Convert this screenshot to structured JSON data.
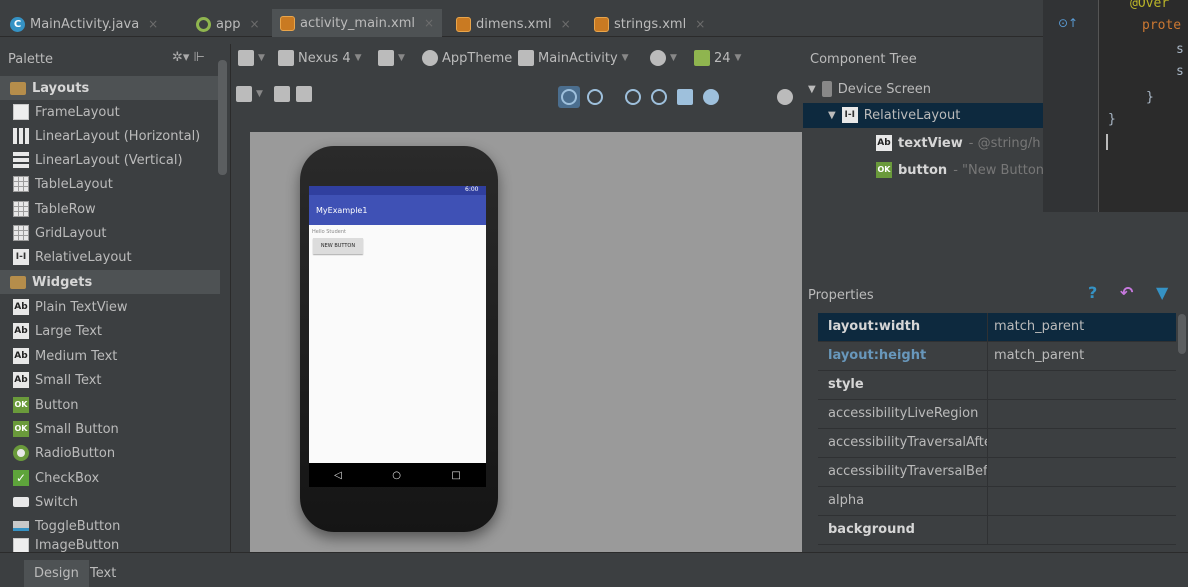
{
  "tabs": [
    {
      "label": "MainActivity.java",
      "icon": "java-class-icon"
    },
    {
      "label": "app",
      "icon": "app-module-icon"
    },
    {
      "label": "activity_main.xml",
      "icon": "xml-file-icon"
    },
    {
      "label": "dimens.xml",
      "icon": "xml-file-icon"
    },
    {
      "label": "strings.xml",
      "icon": "xml-file-icon"
    }
  ],
  "tab_close": "×",
  "palette": {
    "title": "Palette",
    "items": [
      {
        "label": "Layouts",
        "group": true
      },
      {
        "label": "FrameLayout"
      },
      {
        "label": "LinearLayout (Horizontal)"
      },
      {
        "label": "LinearLayout (Vertical)"
      },
      {
        "label": "TableLayout"
      },
      {
        "label": "TableRow"
      },
      {
        "label": "GridLayout"
      },
      {
        "label": "RelativeLayout"
      },
      {
        "label": "Widgets",
        "group": true
      },
      {
        "label": "Plain TextView"
      },
      {
        "label": "Large Text"
      },
      {
        "label": "Medium Text"
      },
      {
        "label": "Small Text"
      },
      {
        "label": "Button"
      },
      {
        "label": "Small Button"
      },
      {
        "label": "RadioButton"
      },
      {
        "label": "CheckBox"
      },
      {
        "label": "Switch"
      },
      {
        "label": "ToggleButton"
      },
      {
        "label": "ImageButton"
      }
    ],
    "icon_text": {
      "ab": "Ab",
      "ok": "OK",
      "rel": "I-I"
    }
  },
  "toolbar": {
    "device": "Nexus 4",
    "theme": "AppTheme",
    "activity": "MainActivity",
    "api": "24"
  },
  "preview": {
    "status_time": "6:00",
    "app_title": "MyExample1",
    "hello_text": "Hello Student",
    "button_text": "NEW BUTTON",
    "nav": [
      "◁",
      "○",
      "□"
    ]
  },
  "component_tree": {
    "title": "Component Tree",
    "device_screen": "Device Screen",
    "relative_layout": "RelativeLayout",
    "text_view": {
      "name": "textView",
      "detail": " - @string/h"
    },
    "button": {
      "name": "button",
      "detail": " - \"New Button"
    }
  },
  "editor": {
    "lines": [
      "@Over",
      "prote",
      "s",
      "s",
      "}",
      "}"
    ]
  },
  "properties": {
    "title": "Properties",
    "rows": [
      {
        "key": "layout:width",
        "value": "match_parent"
      },
      {
        "key": "layout:height",
        "value": "match_parent"
      },
      {
        "key": "style",
        "value": ""
      },
      {
        "key": "accessibilityLiveRegion",
        "value": ""
      },
      {
        "key": "accessibilityTraversalAfte",
        "value": ""
      },
      {
        "key": "accessibilityTraversalBefc",
        "value": ""
      },
      {
        "key": "alpha",
        "value": ""
      },
      {
        "key": "background",
        "value": ""
      }
    ]
  },
  "bottom_tabs": [
    "Design",
    "Text"
  ],
  "colors": {
    "accent_blue": "#3f51b5",
    "status_blue": "#303f9f",
    "selection": "#0d293e"
  }
}
